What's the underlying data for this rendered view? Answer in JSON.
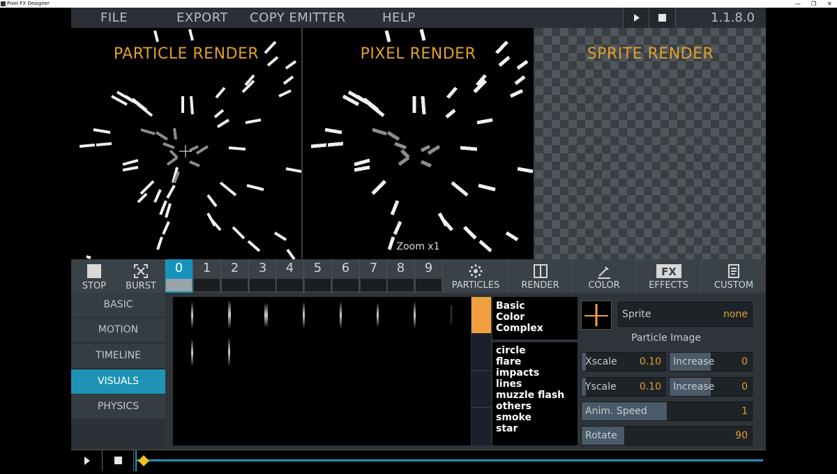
{
  "window": {
    "title": "Pixel FX Designer",
    "controls": [
      "—",
      "❐",
      "✕"
    ]
  },
  "menu": {
    "items": [
      "FILE",
      "EXPORT",
      "COPY EMITTER",
      "HELP"
    ],
    "version": "1.1.8.0"
  },
  "panes": {
    "particle": "PARTICLE RENDER",
    "pixel": "PIXEL RENDER",
    "sprite": "SPRITE RENDER",
    "zoom": "Zoom x1"
  },
  "toolbar": {
    "stop": "STOP",
    "burst": "BURST",
    "slots": [
      "0",
      "1",
      "2",
      "3",
      "4",
      "5",
      "6",
      "7",
      "8",
      "9"
    ],
    "active_slot": "0",
    "categories": [
      "PARTICLES",
      "RENDER",
      "COLOR",
      "EFFECTS",
      "CUSTOM"
    ]
  },
  "sidebar": {
    "items": [
      "BASIC",
      "MOTION",
      "TIMELINE",
      "VISUALS",
      "PHYSICS"
    ],
    "active": "VISUALS"
  },
  "library": {
    "groups": [
      "Basic",
      "Color",
      "Complex"
    ],
    "types": [
      "circle",
      "flare",
      "impacts",
      "lines",
      "muzzle flash",
      "others",
      "smoke",
      "star"
    ]
  },
  "visuals": {
    "sprite_label": "Sprite",
    "sprite_value": "none",
    "particle_image": "Particle Image",
    "xscale": {
      "label": "Xscale",
      "value": "0.10"
    },
    "xinc": {
      "label": "Increase",
      "value": "0"
    },
    "yscale": {
      "label": "Yscale",
      "value": "0.10"
    },
    "yinc": {
      "label": "Increase",
      "value": "0"
    },
    "anim_speed": {
      "label": "Anim. Speed",
      "value": "1"
    },
    "rotate": {
      "label": "Rotate",
      "value": "90"
    }
  },
  "colors": {
    "accent": "#e0a02a",
    "active": "#1e93b5",
    "orange": "#f0a040"
  }
}
